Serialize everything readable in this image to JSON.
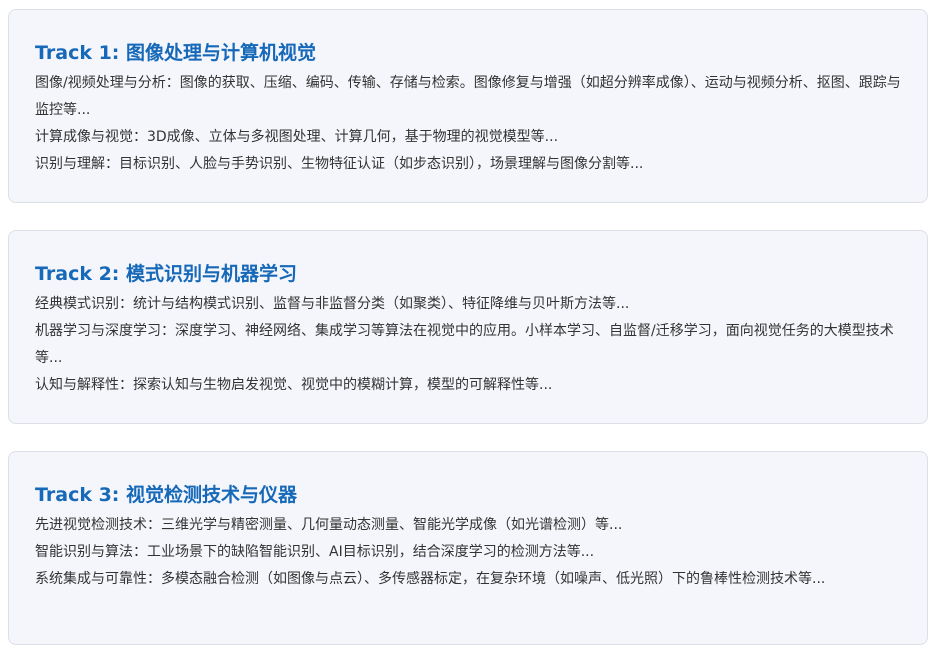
{
  "tracks": [
    {
      "title": "Track 1: 图像处理与计算机视觉",
      "lines": [
        "图像/视频处理与分析：图像的获取、压缩、编码、传输、存储与检索。图像修复与增强（如超分辨率成像）、运动与视频分析、抠图、跟踪与监控等...",
        "计算成像与视觉：3D成像、立体与多视图处理、计算几何，基于物理的视觉模型等...",
        "识别与理解：目标识别、人脸与手势识别、生物特征认证（如步态识别），场景理解与图像分割等..."
      ]
    },
    {
      "title": "Track 2: 模式识别与机器学习",
      "lines": [
        "经典模式识别：统计与结构模式识别、监督与非监督分类（如聚类）、特征降维与贝叶斯方法等...",
        "机器学习与深度学习：深度学习、神经网络、集成学习等算法在视觉中的应用。小样本学习、自监督/迁移学习，面向视觉任务的大模型技术等...",
        "认知与解释性：探索认知与生物启发视觉、视觉中的模糊计算，模型的可解释性等..."
      ]
    },
    {
      "title": "Track 3: 视觉检测技术与仪器",
      "lines": [
        "先进视觉检测技术：三维光学与精密测量、几何量动态测量、智能光学成像（如光谱检测）等...",
        "智能识别与算法：工业场景下的缺陷智能识别、AI目标识别，结合深度学习的检测方法等...",
        "系统集成与可靠性：多模态融合检测（如图像与点云）、多传感器标定，在复杂环境（如噪声、低光照）下的鲁棒性检测技术等..."
      ]
    }
  ]
}
